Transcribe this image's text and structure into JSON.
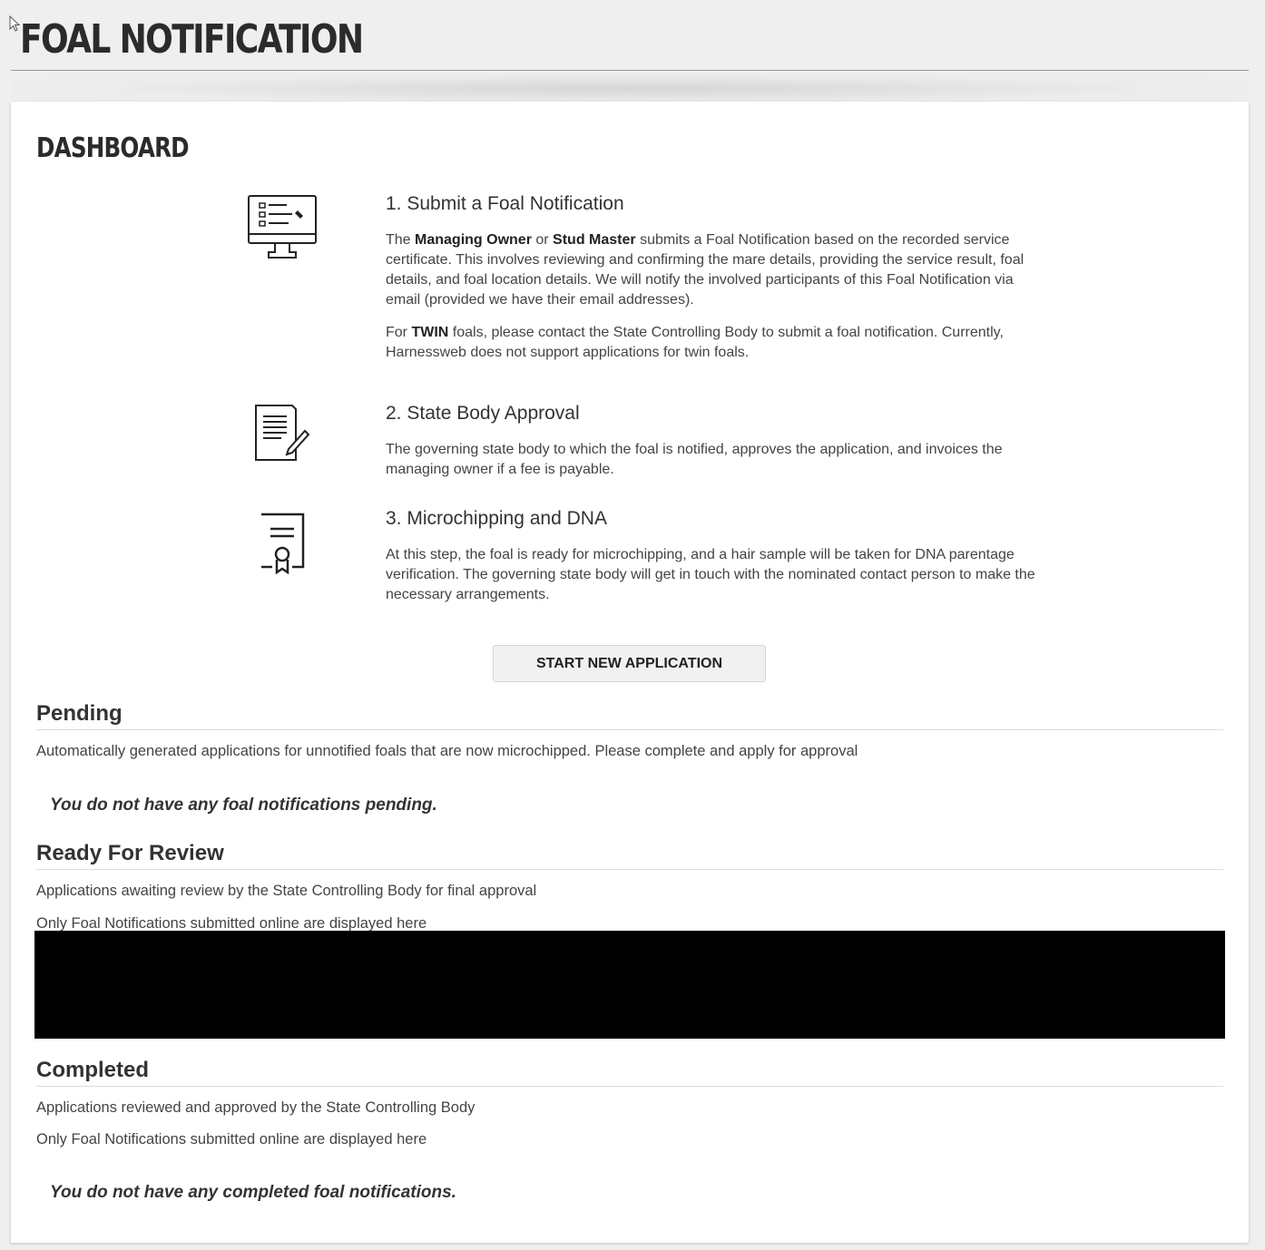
{
  "page_title": "FOAL NOTIFICATION",
  "dashboard_title": "DASHBOARD",
  "steps": [
    {
      "title": "1. Submit a Foal Notification",
      "p1_a": "The ",
      "p1_b1": "Managing Owner",
      "p1_c": " or ",
      "p1_b2": "Stud Master",
      "p1_d": " submits a Foal Notification based on the recorded service certificate. This involves reviewing and confirming the mare details, providing the service result, foal details, and foal location details. We will notify the involved participants of this Foal Notification via email (provided we have their email addresses).",
      "p2_a": "For ",
      "p2_b": "TWIN",
      "p2_c": " foals, please contact the State Controlling Body to submit a foal notification. Currently, Harnessweb does not support applications for twin foals.",
      "icon": "monitor-checklist-icon"
    },
    {
      "title": "2. State Body Approval",
      "p1": "The governing state body to which the foal is notified, approves the application, and invoices the managing owner if a fee is payable.",
      "icon": "document-pen-icon"
    },
    {
      "title": "3. Microchipping and DNA",
      "p1": "At this step, the foal is ready for microchipping, and a hair sample will be taken for DNA parentage verification. The governing state body will get in touch with the nominated contact person to make the necessary arrangements.",
      "icon": "certificate-icon"
    }
  ],
  "start_button_label": "START NEW APPLICATION",
  "pending": {
    "title": "Pending",
    "desc": "Automatically generated applications for unnotified foals that are now microchipped. Please complete and apply for approval",
    "empty": "You do not have any foal notifications pending."
  },
  "review": {
    "title": "Ready For Review",
    "desc1": "Applications awaiting review by the State Controlling Body for final approval",
    "desc2": "Only Foal Notifications submitted online are displayed here"
  },
  "completed": {
    "title": "Completed",
    "desc1": "Applications reviewed and approved by the State Controlling Body",
    "desc2": "Only Foal Notifications submitted online are displayed here",
    "empty": "You do not have any completed foal notifications."
  }
}
